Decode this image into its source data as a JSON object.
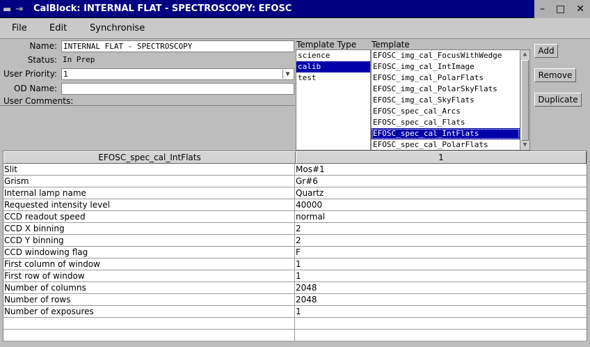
{
  "window": {
    "title": "CalBlock: INTERNAL FLAT - SPECTROSCOPY: EFOSC",
    "controls": {
      "minimize": "–",
      "maximize": "□",
      "close": "✕"
    }
  },
  "menu": {
    "file": "File",
    "edit": "Edit",
    "synchronise": "Synchronise"
  },
  "form": {
    "name_label": "Name:",
    "name_value": "INTERNAL FLAT - SPECTROSCOPY",
    "status_label": "Status:",
    "status_value": "In Prep",
    "priority_label": "User Priority:",
    "priority_value": "1",
    "od_label": "OD Name:",
    "od_value": "",
    "comments_label": "User Comments:"
  },
  "template_type": {
    "header": "Template Type",
    "items": [
      "science",
      "calib",
      "test"
    ],
    "selected": "calib"
  },
  "template": {
    "header": "Template",
    "items": [
      "EFOSC_img_cal_FocusWithWedge",
      "EFOSC_img_cal_IntImage",
      "EFOSC_img_cal_PolarFlats",
      "EFOSC_img_cal_PolarSkyFlats",
      "EFOSC_img_cal_SkyFlats",
      "EFOSC_spec_cal_Arcs",
      "EFOSC_spec_cal_Flats",
      "EFOSC_spec_cal_IntFlats",
      "EFOSC_spec_cal_PolarFlats"
    ],
    "selected": "EFOSC_spec_cal_IntFlats"
  },
  "buttons": {
    "add": "Add",
    "remove": "Remove",
    "duplicate": "Duplicate"
  },
  "table": {
    "header_param": "EFOSC_spec_cal_IntFlats",
    "header_value": "1",
    "rows": [
      {
        "param": "Slit",
        "value": "Mos#1"
      },
      {
        "param": "Grism",
        "value": "Gr#6"
      },
      {
        "param": "Internal lamp name",
        "value": "Quartz"
      },
      {
        "param": "Requested intensity level",
        "value": "40000"
      },
      {
        "param": "CCD readout speed",
        "value": "normal"
      },
      {
        "param": "CCD X binning",
        "value": "2"
      },
      {
        "param": "CCD Y binning",
        "value": "2"
      },
      {
        "param": "CCD windowing flag",
        "value": "F"
      },
      {
        "param": "First column of window",
        "value": "1"
      },
      {
        "param": "First row of window",
        "value": "1"
      },
      {
        "param": "Number of columns",
        "value": "2048"
      },
      {
        "param": "Number of rows",
        "value": "2048"
      },
      {
        "param": "Number of exposures",
        "value": "1"
      },
      {
        "param": "",
        "value": ""
      },
      {
        "param": "",
        "value": ""
      }
    ]
  }
}
